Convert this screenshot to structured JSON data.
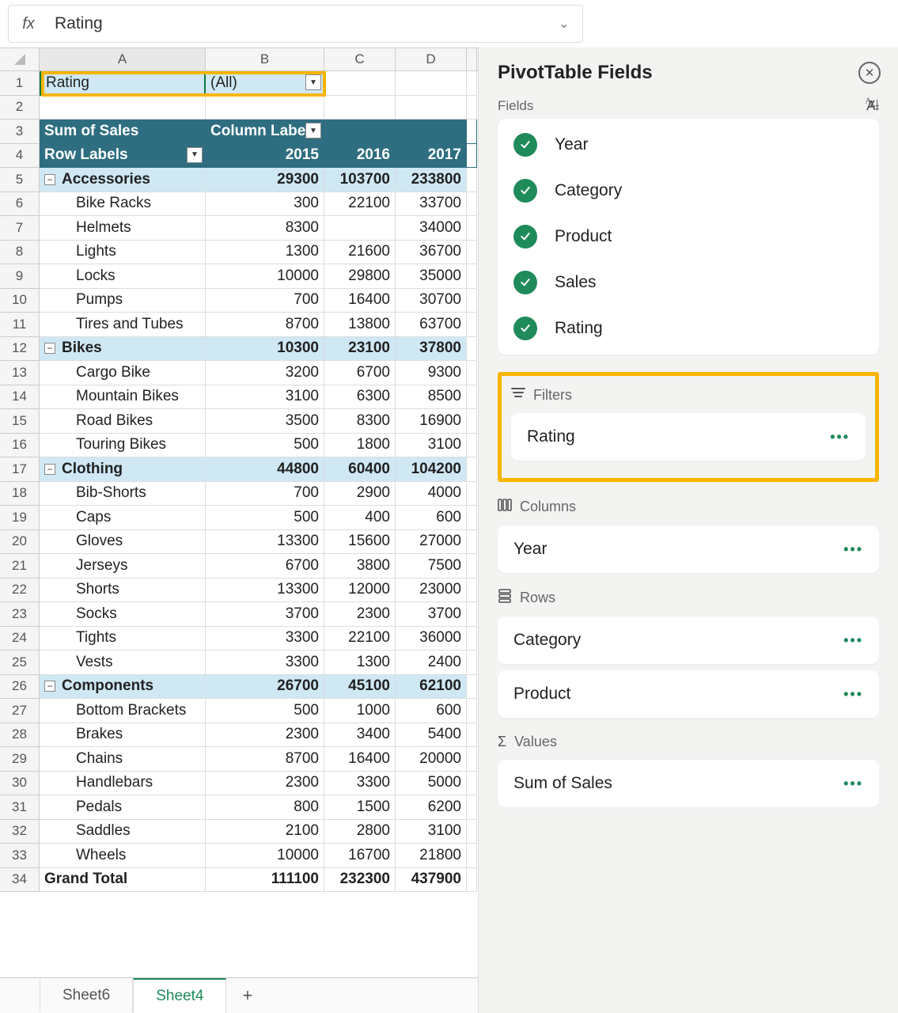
{
  "formula": {
    "fx_label": "fx",
    "value": "Rating"
  },
  "columns": [
    "A",
    "B",
    "C",
    "D",
    ""
  ],
  "filter_row": {
    "label": "Rating",
    "value": "(All)"
  },
  "pivot_header": {
    "sum_label": "Sum of Sales",
    "col_label": "Column Labels"
  },
  "year_header": {
    "row_label": "Row Labels",
    "y1": "2015",
    "y2": "2016",
    "y3": "2017"
  },
  "rows": [
    {
      "type": "cat",
      "label": "Accessories",
      "v": [
        "29300",
        "103700",
        "233800"
      ]
    },
    {
      "type": "item",
      "label": "Bike Racks",
      "v": [
        "300",
        "22100",
        "33700"
      ]
    },
    {
      "type": "item",
      "label": "Helmets",
      "v": [
        "8300",
        "",
        "34000"
      ]
    },
    {
      "type": "item",
      "label": "Lights",
      "v": [
        "1300",
        "21600",
        "36700"
      ]
    },
    {
      "type": "item",
      "label": "Locks",
      "v": [
        "10000",
        "29800",
        "35000"
      ]
    },
    {
      "type": "item",
      "label": "Pumps",
      "v": [
        "700",
        "16400",
        "30700"
      ]
    },
    {
      "type": "item",
      "label": "Tires and Tubes",
      "v": [
        "8700",
        "13800",
        "63700"
      ]
    },
    {
      "type": "cat",
      "label": "Bikes",
      "v": [
        "10300",
        "23100",
        "37800"
      ]
    },
    {
      "type": "item",
      "label": "Cargo Bike",
      "v": [
        "3200",
        "6700",
        "9300"
      ]
    },
    {
      "type": "item",
      "label": "Mountain Bikes",
      "v": [
        "3100",
        "6300",
        "8500"
      ]
    },
    {
      "type": "item",
      "label": "Road Bikes",
      "v": [
        "3500",
        "8300",
        "16900"
      ]
    },
    {
      "type": "item",
      "label": "Touring Bikes",
      "v": [
        "500",
        "1800",
        "3100"
      ]
    },
    {
      "type": "cat",
      "label": "Clothing",
      "v": [
        "44800",
        "60400",
        "104200"
      ]
    },
    {
      "type": "item",
      "label": "Bib-Shorts",
      "v": [
        "700",
        "2900",
        "4000"
      ]
    },
    {
      "type": "item",
      "label": "Caps",
      "v": [
        "500",
        "400",
        "600"
      ]
    },
    {
      "type": "item",
      "label": "Gloves",
      "v": [
        "13300",
        "15600",
        "27000"
      ]
    },
    {
      "type": "item",
      "label": "Jerseys",
      "v": [
        "6700",
        "3800",
        "7500"
      ]
    },
    {
      "type": "item",
      "label": "Shorts",
      "v": [
        "13300",
        "12000",
        "23000"
      ]
    },
    {
      "type": "item",
      "label": "Socks",
      "v": [
        "3700",
        "2300",
        "3700"
      ]
    },
    {
      "type": "item",
      "label": "Tights",
      "v": [
        "3300",
        "22100",
        "36000"
      ]
    },
    {
      "type": "item",
      "label": "Vests",
      "v": [
        "3300",
        "1300",
        "2400"
      ]
    },
    {
      "type": "cat",
      "label": "Components",
      "v": [
        "26700",
        "45100",
        "62100"
      ]
    },
    {
      "type": "item",
      "label": "Bottom Brackets",
      "v": [
        "500",
        "1000",
        "600"
      ]
    },
    {
      "type": "item",
      "label": "Brakes",
      "v": [
        "2300",
        "3400",
        "5400"
      ]
    },
    {
      "type": "item",
      "label": "Chains",
      "v": [
        "8700",
        "16400",
        "20000"
      ]
    },
    {
      "type": "item",
      "label": "Handlebars",
      "v": [
        "2300",
        "3300",
        "5000"
      ]
    },
    {
      "type": "item",
      "label": "Pedals",
      "v": [
        "800",
        "1500",
        "6200"
      ]
    },
    {
      "type": "item",
      "label": "Saddles",
      "v": [
        "2100",
        "2800",
        "3100"
      ]
    },
    {
      "type": "item",
      "label": "Wheels",
      "v": [
        "10000",
        "16700",
        "21800"
      ]
    },
    {
      "type": "grand",
      "label": "Grand Total",
      "v": [
        "111100",
        "232300",
        "437900"
      ]
    }
  ],
  "sheets": {
    "tabs": [
      "Sheet6",
      "Sheet4"
    ],
    "active": "Sheet4"
  },
  "panel": {
    "title": "PivotTable Fields",
    "fields_label": "Fields",
    "fields": [
      "Year",
      "Category",
      "Product",
      "Sales",
      "Rating"
    ],
    "zones": {
      "filters": {
        "label": "Filters",
        "items": [
          "Rating"
        ]
      },
      "columns": {
        "label": "Columns",
        "items": [
          "Year"
        ]
      },
      "rows": {
        "label": "Rows",
        "items": [
          "Category",
          "Product"
        ]
      },
      "values": {
        "label": "Values",
        "items": [
          "Sum of Sales"
        ]
      }
    }
  }
}
